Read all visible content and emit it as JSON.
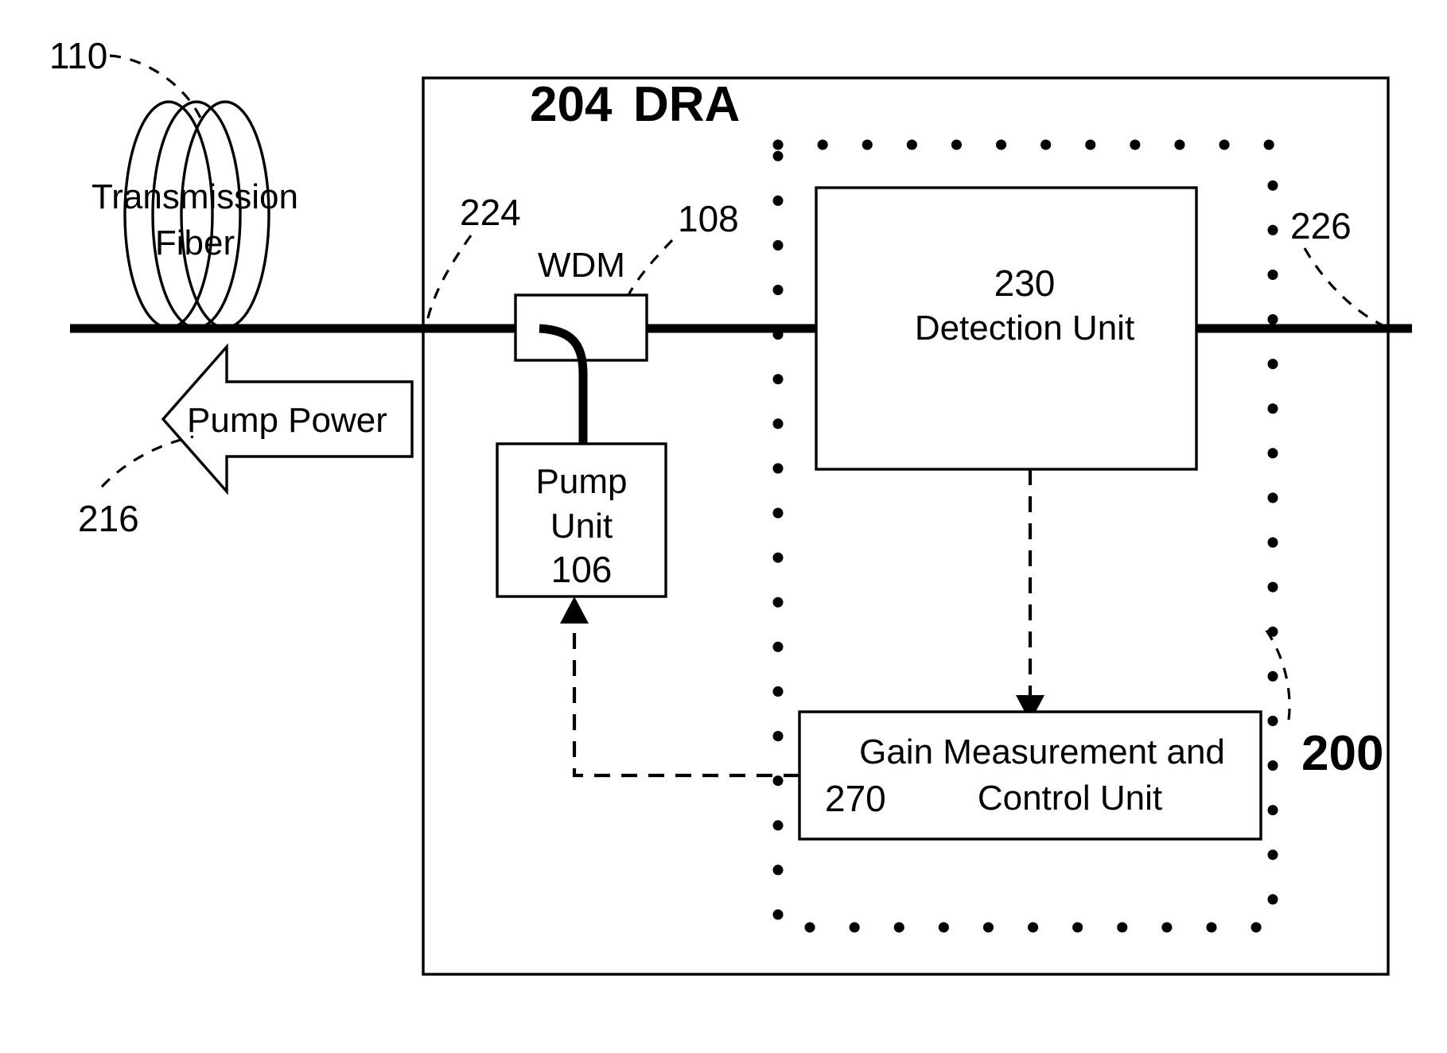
{
  "figure": {
    "title": "Distributed Raman Amplifier block diagram",
    "background_color": "#ffffff",
    "line_color": "#000000"
  },
  "labels": {
    "ref_110": "110",
    "ref_216": "216",
    "ref_224": "224",
    "ref_108": "108",
    "ref_204": "204",
    "ref_226": "226",
    "ref_230": "230",
    "ref_270": "270",
    "ref_106": "106",
    "ref_200": "200"
  },
  "components": {
    "transmission_fiber": {
      "line1": "Transmission",
      "line2": "Fiber",
      "ref": "110"
    },
    "pump_power_arrow": {
      "label": "Pump Power",
      "ref": "216",
      "direction": "left"
    },
    "dra_enclosure": {
      "ref": "204",
      "name": "DRA"
    },
    "wdm": {
      "label": "WDM",
      "ref": "108"
    },
    "pump_unit": {
      "line1": "Pump",
      "line2": "Unit",
      "ref": "106"
    },
    "detection_unit": {
      "ref": "230",
      "label": "Detection Unit"
    },
    "gain_control_unit": {
      "ref": "270",
      "line1": "Gain Measurement and",
      "line2": "Control Unit"
    },
    "dotted_subsystem": {
      "ref": "200"
    },
    "input_port": {
      "ref": "224"
    },
    "output_port": {
      "ref": "226"
    }
  }
}
